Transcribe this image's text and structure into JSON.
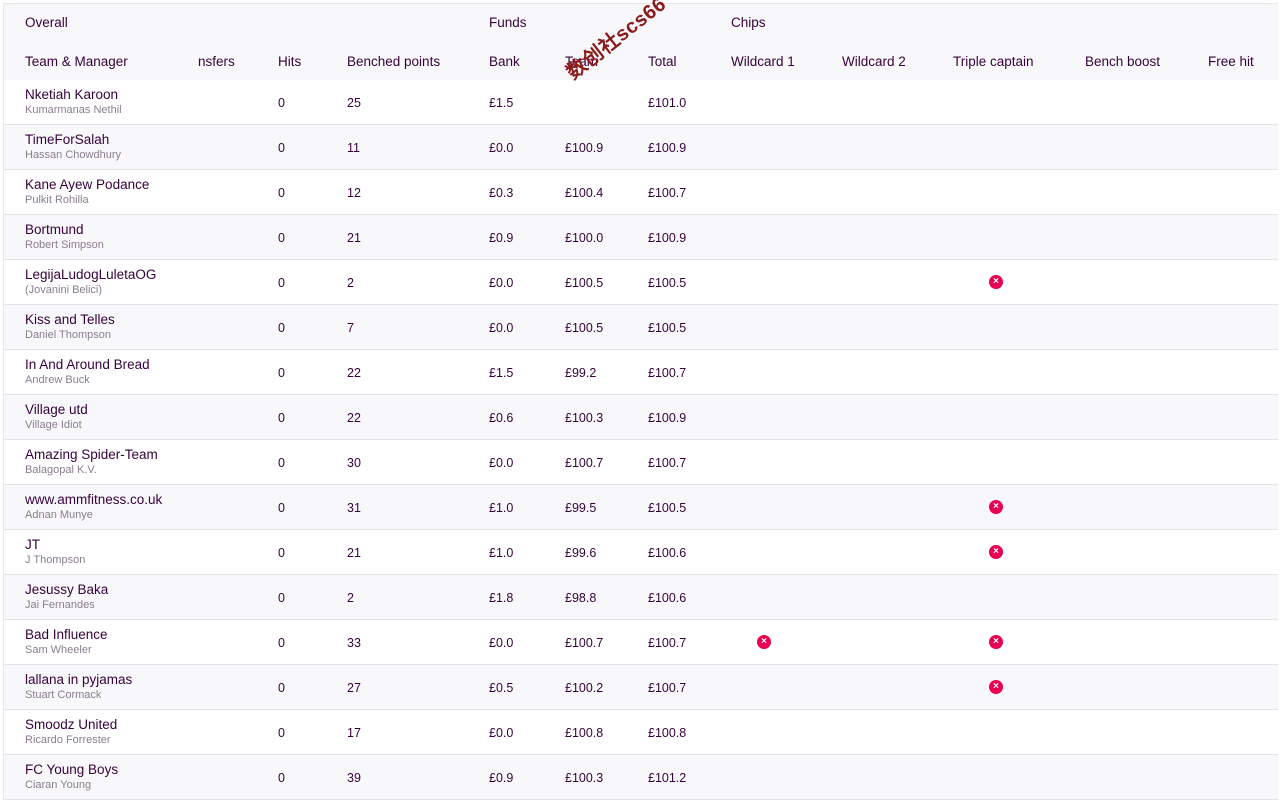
{
  "groups": {
    "overall": "Overall",
    "funds": "Funds",
    "chips": "Chips"
  },
  "headers": {
    "team_manager": "Team & Manager",
    "transfers": "nsfers",
    "hits": "Hits",
    "benched_points": "Benched points",
    "bank": "Bank",
    "team": "Team",
    "total": "Total",
    "wildcard1": "Wildcard 1",
    "wildcard2": "Wildcard 2",
    "triple_captain": "Triple captain",
    "bench_boost": "Bench boost",
    "free_hit": "Free hit"
  },
  "watermark": "数创社scs66",
  "chip_colors": {
    "used": "#e90052"
  },
  "rows": [
    {
      "team": "Nketiah Karoon",
      "manager": "Kumarmanas Nethil",
      "hits": "0",
      "benched": "25",
      "bank": "£1.5",
      "team_value": "",
      "total": "£101.0",
      "wc1": false,
      "tc": false
    },
    {
      "team": "TimeForSalah",
      "manager": "Hassan Chowdhury",
      "hits": "0",
      "benched": "11",
      "bank": "£0.0",
      "team_value": "£100.9",
      "total": "£100.9",
      "wc1": false,
      "tc": false
    },
    {
      "team": "Kane Ayew Podance",
      "manager": "Pulkit Rohilla",
      "hits": "0",
      "benched": "12",
      "bank": "£0.3",
      "team_value": "£100.4",
      "total": "£100.7",
      "wc1": false,
      "tc": false
    },
    {
      "team": "Bortmund",
      "manager": "Robert Simpson",
      "hits": "0",
      "benched": "21",
      "bank": "£0.9",
      "team_value": "£100.0",
      "total": "£100.9",
      "wc1": false,
      "tc": false
    },
    {
      "team": "LegijaLudogLuletaOG",
      "manager": "(Jovanini Belici)",
      "hits": "0",
      "benched": "2",
      "bank": "£0.0",
      "team_value": "£100.5",
      "total": "£100.5",
      "wc1": false,
      "tc": true
    },
    {
      "team": "Kiss and Telles",
      "manager": "Daniel Thompson",
      "hits": "0",
      "benched": "7",
      "bank": "£0.0",
      "team_value": "£100.5",
      "total": "£100.5",
      "wc1": false,
      "tc": false
    },
    {
      "team": "In And Around Bread",
      "manager": "Andrew Buck",
      "hits": "0",
      "benched": "22",
      "bank": "£1.5",
      "team_value": "£99.2",
      "total": "£100.7",
      "wc1": false,
      "tc": false
    },
    {
      "team": "Village utd",
      "manager": "Village Idiot",
      "hits": "0",
      "benched": "22",
      "bank": "£0.6",
      "team_value": "£100.3",
      "total": "£100.9",
      "wc1": false,
      "tc": false
    },
    {
      "team": "Amazing Spider-Team",
      "manager": "Balagopal K.V.",
      "hits": "0",
      "benched": "30",
      "bank": "£0.0",
      "team_value": "£100.7",
      "total": "£100.7",
      "wc1": false,
      "tc": false
    },
    {
      "team": "www.ammfitness.co.uk",
      "manager": "Adnan Munye",
      "hits": "0",
      "benched": "31",
      "bank": "£1.0",
      "team_value": "£99.5",
      "total": "£100.5",
      "wc1": false,
      "tc": true
    },
    {
      "team": "JT",
      "manager": "J Thompson",
      "hits": "0",
      "benched": "21",
      "bank": "£1.0",
      "team_value": "£99.6",
      "total": "£100.6",
      "wc1": false,
      "tc": true
    },
    {
      "team": "Jesussy Baka",
      "manager": "Jai Fernandes",
      "hits": "0",
      "benched": "2",
      "bank": "£1.8",
      "team_value": "£98.8",
      "total": "£100.6",
      "wc1": false,
      "tc": false
    },
    {
      "team": "Bad Influence",
      "manager": "Sam Wheeler",
      "hits": "0",
      "benched": "33",
      "bank": "£0.0",
      "team_value": "£100.7",
      "total": "£100.7",
      "wc1": true,
      "tc": true
    },
    {
      "team": "lallana in pyjamas",
      "manager": "Stuart Cormack",
      "hits": "0",
      "benched": "27",
      "bank": "£0.5",
      "team_value": "£100.2",
      "total": "£100.7",
      "wc1": false,
      "tc": true
    },
    {
      "team": "Smoodz United",
      "manager": "Ricardo Forrester",
      "hits": "0",
      "benched": "17",
      "bank": "£0.0",
      "team_value": "£100.8",
      "total": "£100.8",
      "wc1": false,
      "tc": false
    },
    {
      "team": "FC Young Boys",
      "manager": "Ciaran Young",
      "hits": "0",
      "benched": "39",
      "bank": "£0.9",
      "team_value": "£100.3",
      "total": "£101.2",
      "wc1": false,
      "tc": false
    }
  ]
}
